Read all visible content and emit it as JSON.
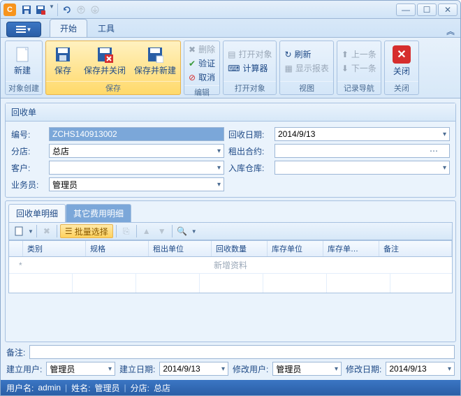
{
  "titlebar": {
    "app_label": "C"
  },
  "tabs": {
    "start": "开始",
    "tools": "工具"
  },
  "ribbon": {
    "new": "新建",
    "new_group": "对象创建",
    "save": "保存",
    "save_close": "保存并关闭",
    "save_new": "保存并新建",
    "save_group": "保存",
    "delete": "删除",
    "validate": "验证",
    "cancel": "取消",
    "edit_group": "编辑",
    "open_obj": "打开对象",
    "calculator": "计算器",
    "open_group": "打开对象",
    "refresh": "刷新",
    "show_report": "显示报表",
    "view_group": "视图",
    "prev": "上一条",
    "next": "下一条",
    "nav_group": "记录导航",
    "close": "关闭",
    "close_group": "关闭"
  },
  "panel": {
    "title": "回收单",
    "labels": {
      "no": "编号:",
      "date": "回收日期:",
      "branch": "分店:",
      "contract": "租出合约:",
      "customer": "客户:",
      "warehouse": "入库仓库:",
      "sales": "业务员:"
    },
    "values": {
      "no": "ZCHS140913002",
      "date": "2014/9/13",
      "branch": "总店",
      "contract": "",
      "customer": "",
      "warehouse": "",
      "sales": "管理员"
    }
  },
  "subtabs": {
    "detail": "回收单明细",
    "other": "其它费用明细"
  },
  "toolbar2": {
    "batch": "批量选择"
  },
  "grid": {
    "cols": {
      "cat": "类别",
      "spec": "规格",
      "unit_out": "租出单位",
      "qty": "回收数量",
      "unit_stock": "库存单位",
      "qty_stock": "库存单…",
      "remark": "备注"
    },
    "newrow": "新增资料"
  },
  "remark_label": "备注:",
  "footer": {
    "create_user_l": "建立用户:",
    "create_user": "管理员",
    "create_date_l": "建立日期:",
    "create_date": "2014/9/13",
    "mod_user_l": "修改用户:",
    "mod_user": "管理员",
    "mod_date_l": "修改日期:",
    "mod_date": "2014/9/13"
  },
  "status": {
    "user_l": "用户名:",
    "user": "admin",
    "name_l": "姓名:",
    "name": "管理员",
    "branch_l": "分店:",
    "branch": "总店"
  }
}
